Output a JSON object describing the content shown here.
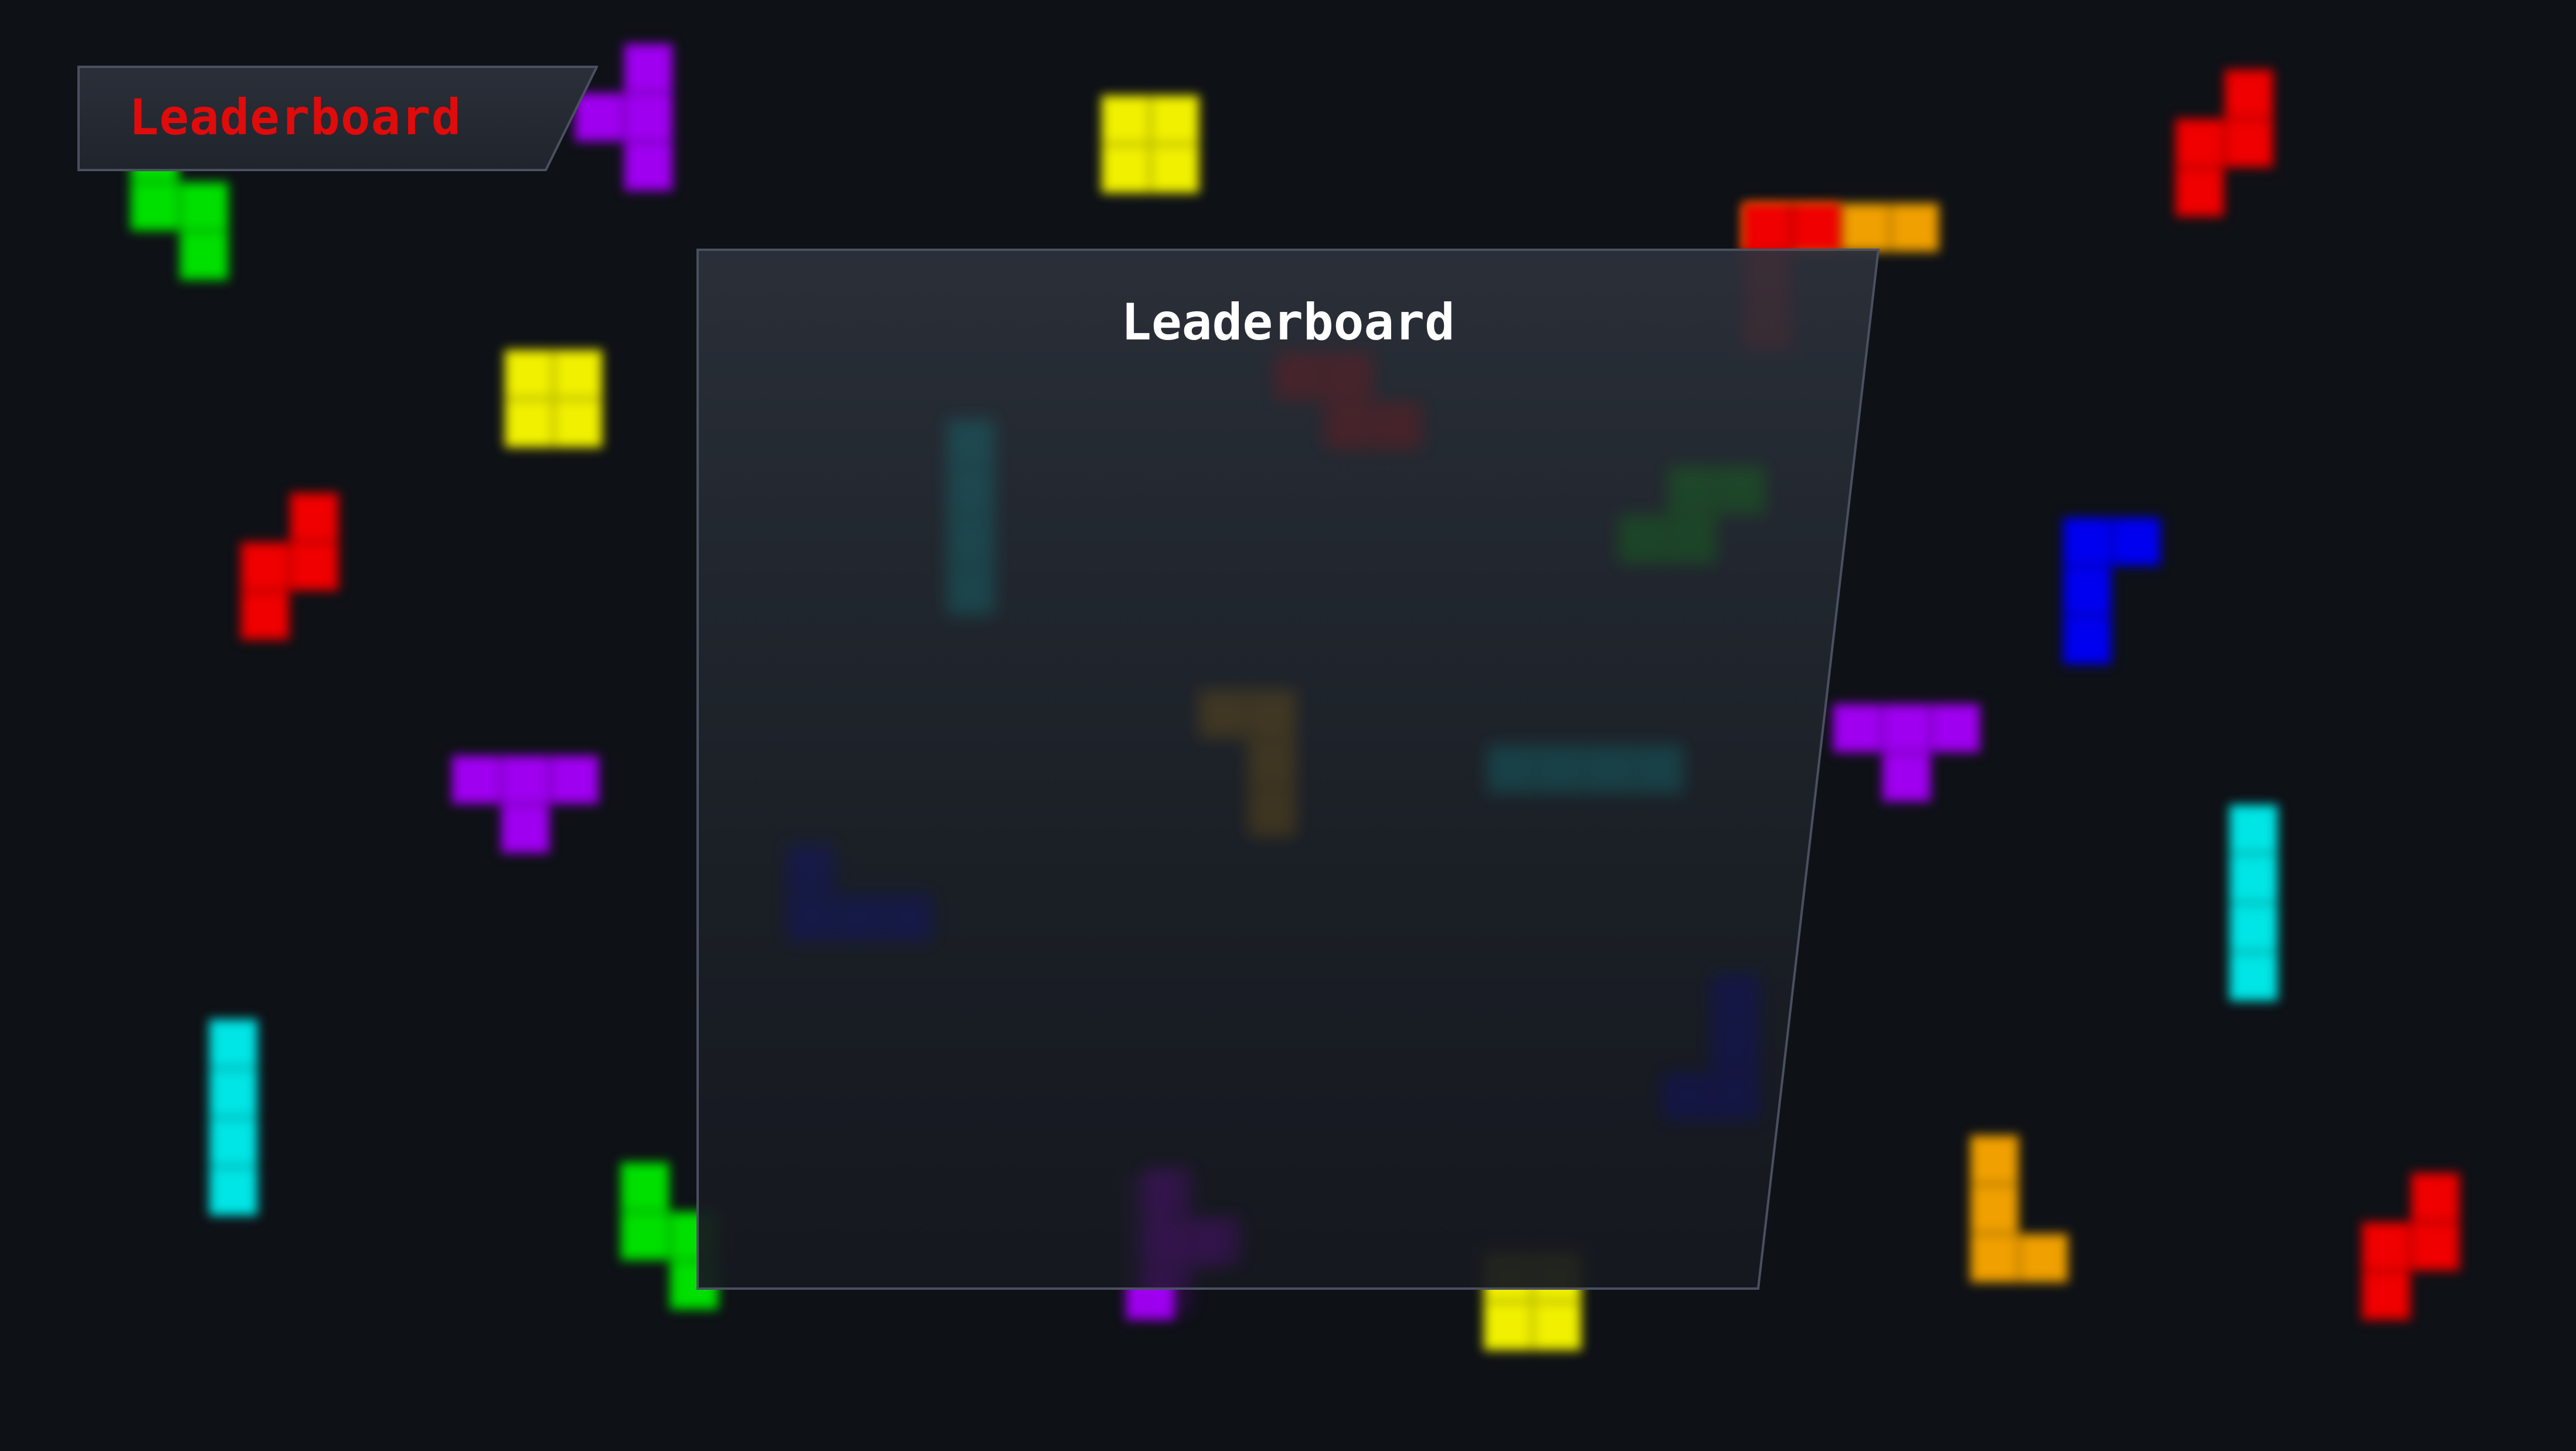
{
  "game": {
    "tab_label": "Leaderboard",
    "panel_title": "Leaderboard"
  },
  "colors": {
    "background": "#0e1116",
    "tab_text": "#e00b0b",
    "panel_title": "#ffffff",
    "panel_border": "#4a5060",
    "pieces": {
      "I": "#00e5e5",
      "O": "#f0f000",
      "T": "#9f00f0",
      "S": "#00e000",
      "Z": "#f00000",
      "J": "#0000f0",
      "L": "#f0a000"
    }
  },
  "background_pieces": [
    {
      "type": "T"
    },
    {
      "type": "O"
    },
    {
      "type": "Z"
    },
    {
      "type": "S"
    },
    {
      "type": "O"
    },
    {
      "type": "Z"
    },
    {
      "type": "T"
    },
    {
      "type": "I"
    },
    {
      "type": "S"
    },
    {
      "type": "T"
    },
    {
      "type": "O"
    },
    {
      "type": "L"
    },
    {
      "type": "Z"
    },
    {
      "type": "J"
    },
    {
      "type": "T"
    },
    {
      "type": "I"
    },
    {
      "type": "L"
    },
    {
      "type": "Z"
    }
  ],
  "panel_pieces": [
    {
      "type": "I"
    },
    {
      "type": "Z"
    },
    {
      "type": "S"
    },
    {
      "type": "L"
    },
    {
      "type": "I"
    },
    {
      "type": "J"
    },
    {
      "type": "J"
    },
    {
      "type": "T"
    }
  ]
}
